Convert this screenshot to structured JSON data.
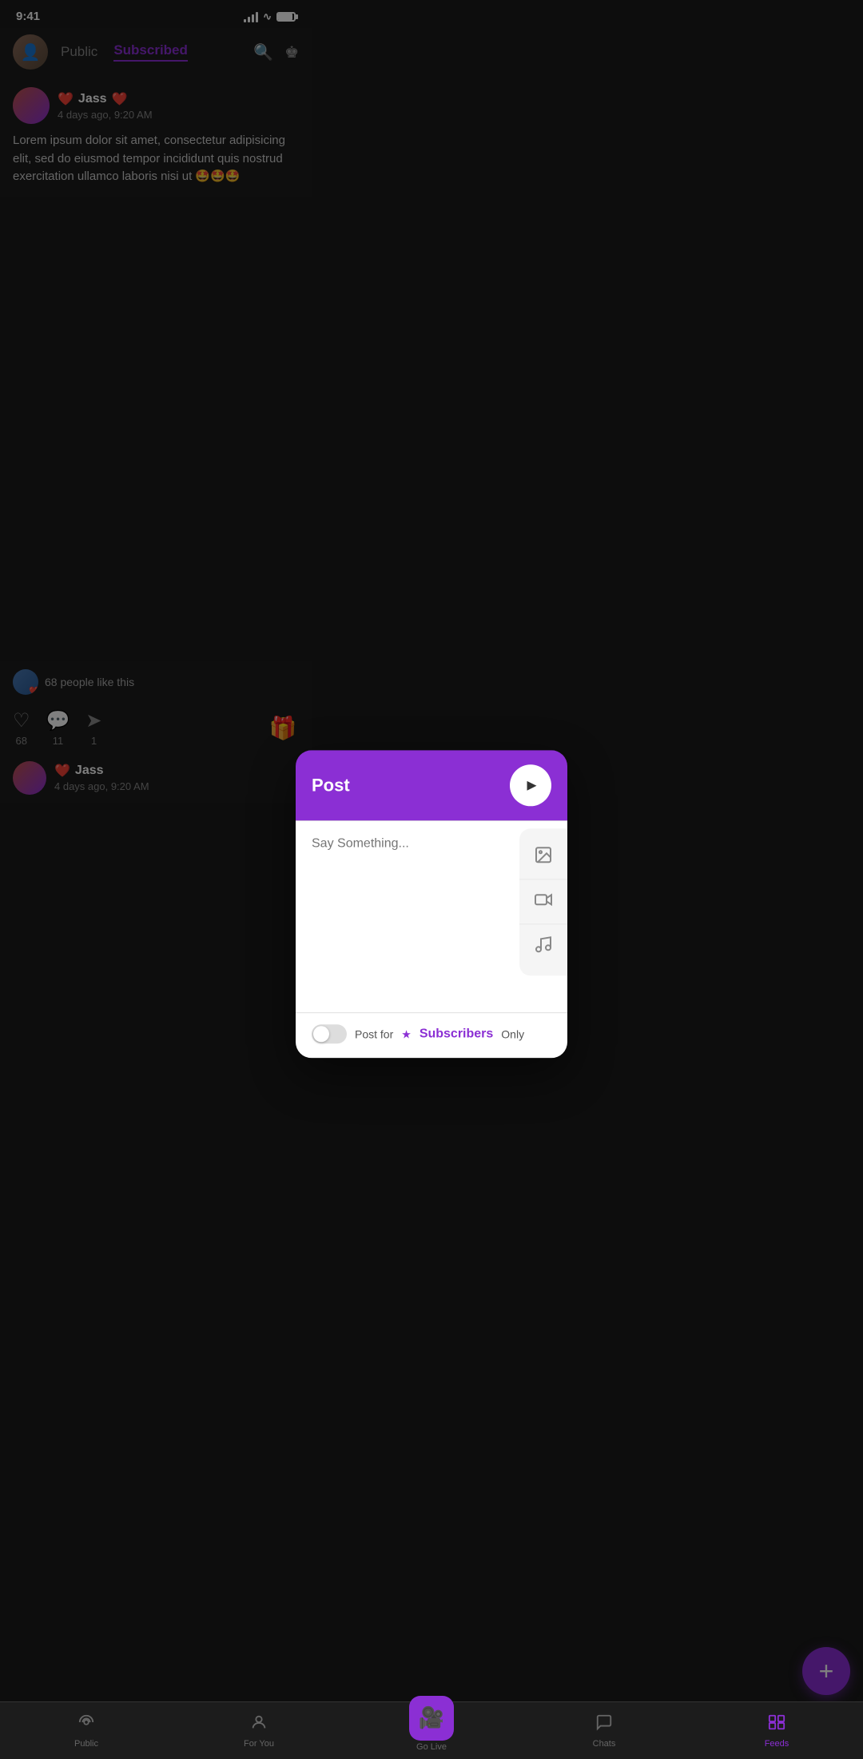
{
  "status_bar": {
    "time": "9:41",
    "signal_level": 4,
    "wifi": true,
    "battery_percent": 90
  },
  "header": {
    "tab_public": "Public",
    "tab_subscribed": "Subscribed",
    "active_tab": "subscribed"
  },
  "feed": {
    "post1": {
      "username": "Jass",
      "time": "4 days ago, 9:20 AM",
      "text": "Lorem ipsum dolor sit amet, consectetur adipisicing elit, sed do eiusmod tempor incididunt  quis nostrud exercitation ullamco laboris nisi ut 🤩🤩🤩",
      "likes_count": "68",
      "comments_count": "11",
      "shares_count": "1",
      "likes_label": "68 people like this"
    },
    "post2": {
      "username": "Jass",
      "time": "4 days ago, 9:20 AM"
    }
  },
  "post_modal": {
    "title": "Post",
    "placeholder": "Say Something...",
    "send_btn_label": "▶",
    "post_for_text": "Post for",
    "subscribers_label": "Subscribers",
    "only_text": "Only",
    "toggle_on": false,
    "media_btn_image": "image-icon",
    "media_btn_video": "video-icon",
    "media_btn_music": "music-icon"
  },
  "bottom_nav": {
    "items": [
      {
        "label": "Public",
        "icon": "broadcast-icon",
        "active": false
      },
      {
        "label": "For You",
        "icon": "person-icon",
        "active": false
      },
      {
        "label": "Go Live",
        "icon": "camera-icon",
        "active": false,
        "special": true
      },
      {
        "label": "Chats",
        "icon": "chat-icon",
        "active": false
      },
      {
        "label": "Feeds",
        "icon": "feeds-icon",
        "active": true
      }
    ]
  },
  "fab": {
    "label": "+"
  }
}
